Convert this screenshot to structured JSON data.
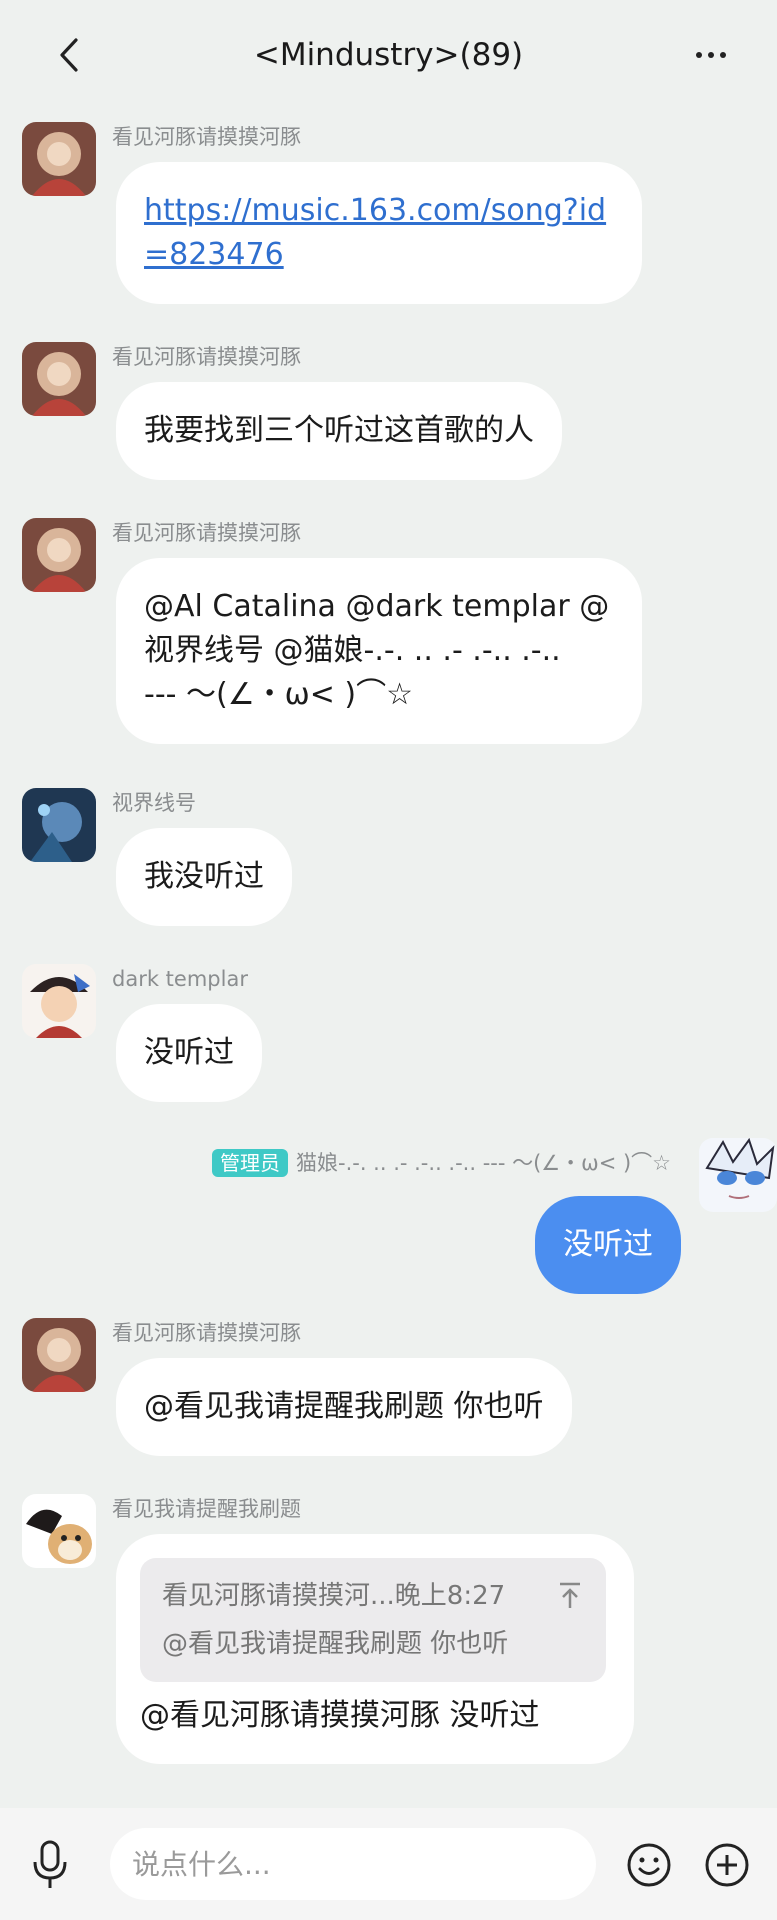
{
  "header": {
    "title": "<Mindustry>(89)"
  },
  "messages": [
    {
      "sender": "看见河豚请摸摸河豚",
      "lines": [
        "https://music.163.com/song?id",
        "=823476"
      ]
    },
    {
      "sender": "看见河豚请摸摸河豚",
      "text": "我要找到三个听过这首歌的人"
    },
    {
      "sender": "看见河豚请摸摸河豚",
      "lines": [
        "@Al Catalina @dark templar @",
        "视界线号 @猫娘-.-. .. .- .-.. .-..",
        "--- ～(∠・ω< )⌒☆"
      ]
    },
    {
      "sender": "视界线号",
      "text": "我没听过"
    },
    {
      "sender": "dark templar",
      "text": "没听过"
    },
    {
      "badge": "管理员",
      "sender": "猫娘-.-. .. .- .-.. .-.. --- ～(∠・ω< )⌒☆",
      "text": "没听过"
    },
    {
      "sender": "看见河豚请摸摸河豚",
      "text": "@看见我请提醒我刷题 你也听"
    },
    {
      "sender": "看见我请提醒我刷题",
      "quote": {
        "header": "看见河豚请摸摸河...晚上8:27",
        "text": "@看见我请提醒我刷题 你也听"
      },
      "text": "@看见河豚请摸摸河豚 没听过"
    }
  ],
  "input": {
    "placeholder": "说点什么..."
  },
  "colors": {
    "accent": "#4b8ef0",
    "badge": "#3fc9c6",
    "background": "#eef1ef"
  }
}
